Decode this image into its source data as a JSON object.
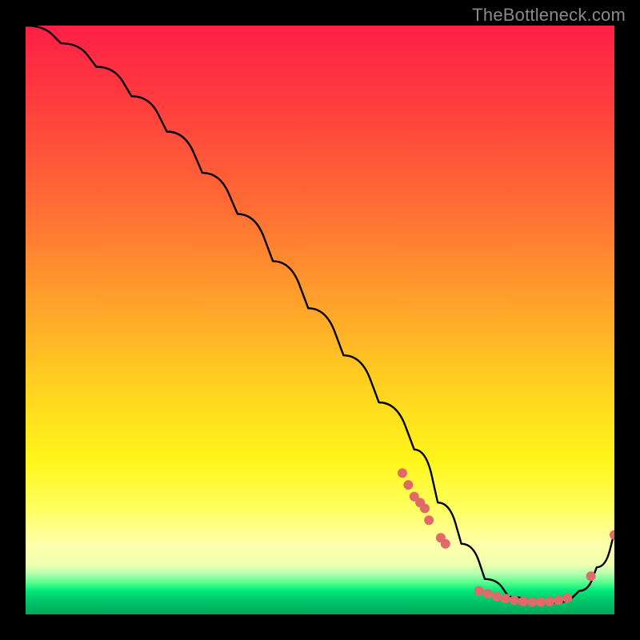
{
  "watermark": "TheBottleneck.com",
  "chart_data": {
    "type": "line",
    "title": "",
    "xlabel": "",
    "ylabel": "",
    "xlim": [
      0,
      100
    ],
    "ylim": [
      0,
      100
    ],
    "grid": false,
    "legend": false,
    "series": [
      {
        "name": "curve",
        "x": [
          0,
          6,
          12,
          18,
          24,
          30,
          36,
          42,
          48,
          54,
          60,
          66,
          70,
          74,
          78,
          82,
          86,
          90,
          94,
          97,
          100
        ],
        "values": [
          100,
          97,
          93,
          88,
          82,
          75,
          68,
          60,
          52,
          44,
          36,
          28,
          19,
          12,
          6,
          3,
          2,
          2,
          4,
          8,
          14
        ]
      }
    ],
    "markers": [
      {
        "name": "cluster-a",
        "color": "#e06a6a",
        "points": [
          {
            "x": 64,
            "y": 24
          },
          {
            "x": 65,
            "y": 22
          },
          {
            "x": 66,
            "y": 20
          },
          {
            "x": 67,
            "y": 19
          },
          {
            "x": 67.8,
            "y": 18
          },
          {
            "x": 68.5,
            "y": 16
          },
          {
            "x": 70.5,
            "y": 13
          },
          {
            "x": 71.3,
            "y": 12
          }
        ]
      },
      {
        "name": "cluster-b",
        "color": "#e06a6a",
        "points": [
          {
            "x": 77,
            "y": 4.0
          },
          {
            "x": 78.5,
            "y": 3.5
          },
          {
            "x": 80,
            "y": 3.0
          },
          {
            "x": 81.5,
            "y": 2.7
          },
          {
            "x": 83,
            "y": 2.4
          },
          {
            "x": 84.5,
            "y": 2.2
          },
          {
            "x": 86,
            "y": 2.1
          },
          {
            "x": 87.5,
            "y": 2.1
          },
          {
            "x": 89,
            "y": 2.2
          },
          {
            "x": 90.5,
            "y": 2.4
          },
          {
            "x": 92,
            "y": 2.8
          }
        ]
      },
      {
        "name": "cluster-c",
        "color": "#e06a6a",
        "points": [
          {
            "x": 96,
            "y": 6.5
          },
          {
            "x": 100,
            "y": 13.5
          }
        ]
      }
    ]
  }
}
